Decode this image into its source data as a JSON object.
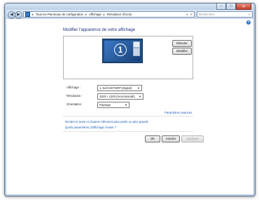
{
  "window": {
    "caption_buttons": {
      "minimize": "–",
      "maximize": "□",
      "close": "✕"
    }
  },
  "nav": {
    "back_icon": "back-arrow-icon",
    "forward_icon": "forward-arrow-icon",
    "breadcrumb": [
      "Tous les Panneaux de configuration",
      "Affichage",
      "Résolution d'écran"
    ],
    "separator": "►",
    "search_placeholder": "Rechercher"
  },
  "page": {
    "title": "Modifier l'apparence de votre affichage",
    "monitor_number": "1",
    "buttons": {
      "detect": "Détecter",
      "identify": "Identifier"
    }
  },
  "settings": {
    "display_label": "Affichage :",
    "display_value": "1. Dell 2407WFP (Digital)",
    "resolution_label": "Résolution :",
    "resolution_value": "1920 × 1200 (recommandé)",
    "orientation_label": "Orientation :",
    "orientation_value": "Paysage",
    "advanced_link": "Paramètres avancés"
  },
  "links": {
    "text_size": "Rendre le texte et d'autres éléments plus petits ou plus grands",
    "which_settings": "Quels paramètres d'affichage choisir ?"
  },
  "footer": {
    "ok": "OK",
    "cancel": "Annuler",
    "apply": "Appliquer"
  },
  "colors": {
    "link": "#1e5dbd",
    "title": "#1e3287",
    "window_frame": "#b9cde3"
  }
}
